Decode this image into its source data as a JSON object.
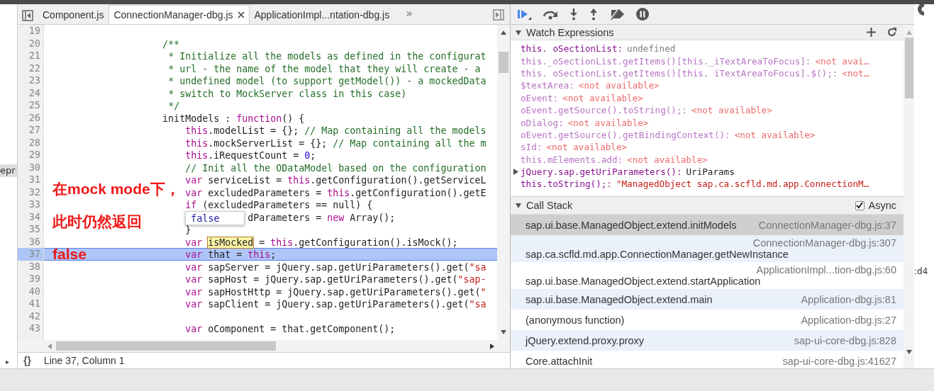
{
  "left_edge": {
    "text": "epr",
    "arrow": "▸"
  },
  "editor_tabs": [
    {
      "label": "Component.js",
      "selected": false
    },
    {
      "label": "ConnectionManager-dbg.js",
      "selected": true
    },
    {
      "label": "ApplicationImpl...ntation-dbg.js",
      "selected": false
    }
  ],
  "tabs_overflow": "»",
  "code_lines": [
    {
      "number": "19",
      "current": false
    },
    {
      "number": "20",
      "current": false,
      "tokens": [
        {
          "kind": "comment",
          "text": "                    /**"
        }
      ]
    },
    {
      "number": "21",
      "current": false,
      "tokens": [
        {
          "kind": "comment",
          "text": "                     * Initialize all the models as defined in the configurat"
        }
      ]
    },
    {
      "number": "22",
      "current": false,
      "tokens": [
        {
          "kind": "comment",
          "text": "                     * url - the name of the model that they will create - a"
        }
      ]
    },
    {
      "number": "23",
      "current": false,
      "tokens": [
        {
          "kind": "comment",
          "text": "                     * undefined model (to support getModel()) - a mockedData"
        }
      ]
    },
    {
      "number": "24",
      "current": false,
      "tokens": [
        {
          "kind": "comment",
          "text": "                     * switch to MockServer class in this case)"
        }
      ]
    },
    {
      "number": "25",
      "current": false,
      "tokens": [
        {
          "kind": "comment",
          "text": "                     */"
        }
      ]
    },
    {
      "number": "26",
      "current": false,
      "tokens": [
        {
          "kind": "plain",
          "text": "                    initModels : "
        },
        {
          "kind": "keyword",
          "text": "function"
        },
        {
          "kind": "plain",
          "text": "() {"
        }
      ]
    },
    {
      "number": "27",
      "current": false,
      "tokens": [
        {
          "kind": "keyword",
          "text": "                        this"
        },
        {
          "kind": "plain",
          "text": ".modelList = {}; "
        },
        {
          "kind": "comment",
          "text": "// Map containing all the models"
        }
      ]
    },
    {
      "number": "28",
      "current": false,
      "tokens": [
        {
          "kind": "keyword",
          "text": "                        this"
        },
        {
          "kind": "plain",
          "text": ".mockServerList = {}; "
        },
        {
          "kind": "comment",
          "text": "// Map containing all the m"
        }
      ]
    },
    {
      "number": "29",
      "current": false,
      "tokens": [
        {
          "kind": "keyword",
          "text": "                        this"
        },
        {
          "kind": "plain",
          "text": ".iRequestCount = "
        },
        {
          "kind": "number",
          "text": "0"
        },
        {
          "kind": "plain",
          "text": ";"
        }
      ]
    },
    {
      "number": "30",
      "current": false,
      "tokens": [
        {
          "kind": "comment",
          "text": "                        // Init all the ODataModel based on the configuration"
        }
      ]
    },
    {
      "number": "31",
      "current": false,
      "tokens": [
        {
          "kind": "keyword",
          "text": "                        var"
        },
        {
          "kind": "plain",
          "text": " serviceList = "
        },
        {
          "kind": "keyword",
          "text": "this"
        },
        {
          "kind": "plain",
          "text": ".getConfiguration().getServiceL"
        }
      ]
    },
    {
      "number": "32",
      "current": false,
      "tokens": [
        {
          "kind": "keyword",
          "text": "                        var"
        },
        {
          "kind": "plain",
          "text": " excludedParameters = "
        },
        {
          "kind": "keyword",
          "text": "this"
        },
        {
          "kind": "plain",
          "text": ".getConfiguration().getE"
        }
      ]
    },
    {
      "number": "33",
      "current": false,
      "tokens": [
        {
          "kind": "keyword",
          "text": "                        if"
        },
        {
          "kind": "plain",
          "text": " (excludedParameters == null) {"
        }
      ]
    },
    {
      "number": "34",
      "current": false,
      "tokens": [
        {
          "kind": "plain",
          "text": "                                   dParameters = "
        },
        {
          "kind": "keyword",
          "text": "new"
        },
        {
          "kind": "plain",
          "text": " Array();"
        }
      ]
    },
    {
      "number": "35",
      "current": false,
      "tokens": [
        {
          "kind": "plain",
          "text": "                        }"
        }
      ]
    },
    {
      "number": "36",
      "current": false,
      "tokens": [
        {
          "kind": "keyword",
          "text": "                        var "
        },
        {
          "kind": "match",
          "text": "isMocked"
        },
        {
          "kind": "plain",
          "text": " = "
        },
        {
          "kind": "keyword",
          "text": "this"
        },
        {
          "kind": "plain",
          "text": ".getConfiguration().isMock();"
        }
      ]
    },
    {
      "number": "37",
      "current": true,
      "tokens": [
        {
          "kind": "keyword",
          "text": "                        var"
        },
        {
          "kind": "plain",
          "text": " that = "
        },
        {
          "kind": "keyword",
          "text": "this"
        },
        {
          "kind": "plain",
          "text": ";"
        }
      ]
    },
    {
      "number": "38",
      "current": false,
      "tokens": [
        {
          "kind": "keyword",
          "text": "                        var"
        },
        {
          "kind": "plain",
          "text": " sapServer = jQuery.sap.getUriParameters().get("
        },
        {
          "kind": "string",
          "text": "\"sa"
        }
      ]
    },
    {
      "number": "39",
      "current": false,
      "tokens": [
        {
          "kind": "keyword",
          "text": "                        var"
        },
        {
          "kind": "plain",
          "text": " sapHost = jQuery.sap.getUriParameters().get("
        },
        {
          "kind": "string",
          "text": "\"sap-"
        }
      ]
    },
    {
      "number": "40",
      "current": false,
      "tokens": [
        {
          "kind": "keyword",
          "text": "                        var"
        },
        {
          "kind": "plain",
          "text": " sapHostHttp = jQuery.sap.getUriParameters().get("
        },
        {
          "kind": "string",
          "text": "\""
        }
      ]
    },
    {
      "number": "41",
      "current": false,
      "tokens": [
        {
          "kind": "keyword",
          "text": "                        var"
        },
        {
          "kind": "plain",
          "text": " sapClient = jQuery.sap.getUriParameters().get("
        },
        {
          "kind": "string",
          "text": "\"sa"
        }
      ]
    },
    {
      "number": "42",
      "current": false
    },
    {
      "number": "43",
      "current": false,
      "tokens": [
        {
          "kind": "keyword",
          "text": "                        var"
        },
        {
          "kind": "plain",
          "text": " oComponent = that.getComponent();"
        }
      ]
    }
  ],
  "value_tooltip": "false",
  "annotation": [
    "在mock mode下，",
    "此时仍然返回",
    "false"
  ],
  "status_bar": {
    "format_glyph": "{}",
    "position": "Line 37, Column 1"
  },
  "watch": {
    "title": "Watch Expressions",
    "expanded": true,
    "items": [
      {
        "name": "this. oSectionList:",
        "dimmed": false,
        "expandable": false,
        "value": "undefined",
        "kind": "undefined"
      },
      {
        "name": "this._oSectionList.getItems()[this._iTextAreaToFocus]:",
        "dimmed": true,
        "expandable": false,
        "value": "<not avai…",
        "kind": "unavailable"
      },
      {
        "name": "this. oSectionList.getItems()[this. iTextAreaToFocus].$();:",
        "dimmed": true,
        "expandable": false,
        "value": "<not…",
        "kind": "unavailable"
      },
      {
        "name": "$textArea:",
        "dimmed": true,
        "expandable": false,
        "value": "<not available>",
        "kind": "unavailable"
      },
      {
        "name": "oEvent:",
        "dimmed": true,
        "expandable": false,
        "value": "<not available>",
        "kind": "unavailable"
      },
      {
        "name": "oEvent.getSource().toString();:",
        "dimmed": true,
        "expandable": false,
        "value": "<not available>",
        "kind": "unavailable"
      },
      {
        "name": "oDialog:",
        "dimmed": true,
        "expandable": false,
        "value": "<not available>",
        "kind": "unavailable"
      },
      {
        "name": "oEvent.getSource().getBindingContext():",
        "dimmed": true,
        "expandable": false,
        "value": "<not available>",
        "kind": "unavailable"
      },
      {
        "name": "sId:",
        "dimmed": true,
        "expandable": false,
        "value": "<not available>",
        "kind": "unavailable"
      },
      {
        "name": "this.mElements.add:",
        "dimmed": true,
        "expandable": false,
        "value": "<not available>",
        "kind": "unavailable"
      },
      {
        "name": "jQuery.sap.getUriParameters():",
        "dimmed": false,
        "expandable": true,
        "value": "UriParams",
        "kind": "object"
      },
      {
        "name": "this.toString();:",
        "dimmed": false,
        "expandable": false,
        "value": "\"ManagedObject sap.ca.scfld.md.app.ConnectionM…",
        "kind": "string"
      }
    ]
  },
  "call_stack": {
    "title": "Call Stack",
    "expanded": true,
    "async": {
      "label": "Async",
      "checked": true
    },
    "frames": [
      {
        "function": "sap.ui.base.ManagedObject.extend.initModels",
        "location": "ConnectionManager-dbg.js:37",
        "selected": true
      },
      {
        "function": "sap.ca.scfld.md.app.ConnectionManager.getNewInstance",
        "location": "ConnectionManager-dbg.js:307",
        "selected": false
      },
      {
        "function": "sap.ui.base.ManagedObject.extend.startApplication",
        "location": "ApplicationImpl...tion-dbg.js:60",
        "selected": false
      },
      {
        "function": "sap.ui.base.ManagedObject.extend.main",
        "location": "Application-dbg.js:81",
        "selected": false
      },
      {
        "function": "(anonymous function)",
        "location": "Application-dbg.js:27",
        "selected": false
      },
      {
        "function": "jQuery.extend.proxy.proxy",
        "location": "sap-ui-core-dbg.js:828",
        "selected": false
      },
      {
        "function": "Core.attachInit",
        "location": "sap-ui-core-dbg.js:41627",
        "selected": false
      }
    ]
  },
  "right_edge": {
    "text": ":d4"
  }
}
